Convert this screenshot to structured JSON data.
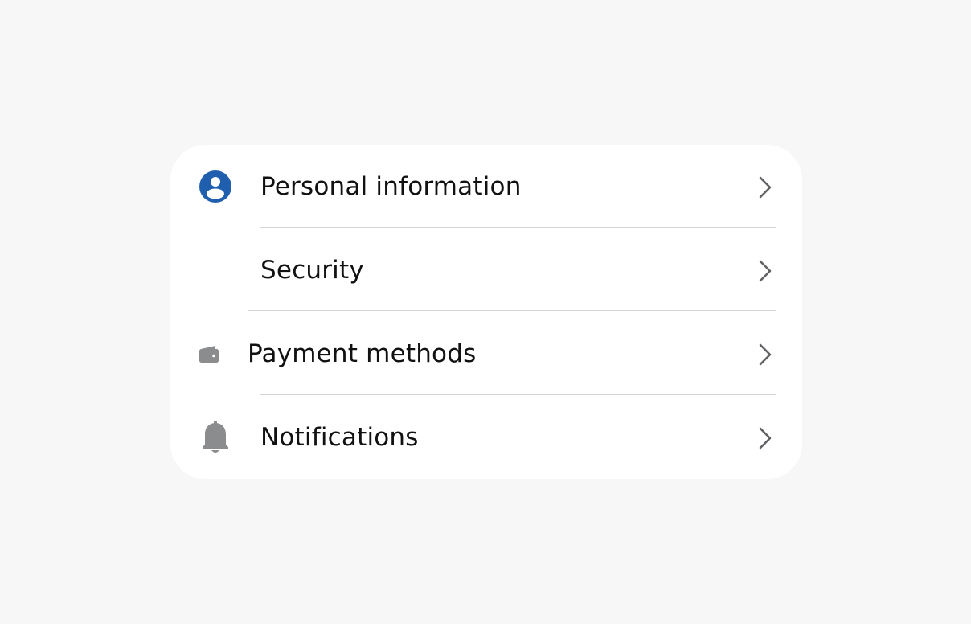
{
  "colors": {
    "page_background": "#f6f7f6",
    "card_background": "#ffffff",
    "accent": "#1f5fae",
    "icon_gray": "#8a8c8e",
    "chevron": "#606265",
    "divider": "#d5d5d5"
  },
  "settings_list": {
    "items": [
      {
        "label": "Personal information",
        "icon": "user-circle-icon"
      },
      {
        "label": "Security",
        "icon": "none"
      },
      {
        "label": "Payment methods",
        "icon": "wallet-icon"
      },
      {
        "label": "Notifications",
        "icon": "bell-icon"
      }
    ]
  }
}
